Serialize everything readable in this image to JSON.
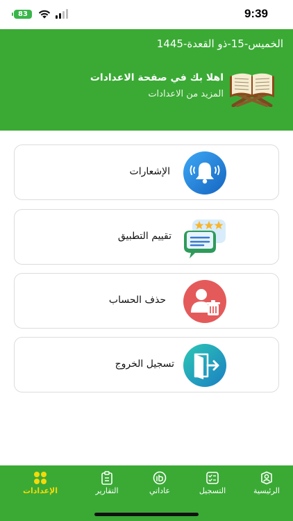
{
  "status_bar": {
    "battery": "83",
    "time": "9:39",
    "wifi_icon": "wifi-icon",
    "signal_icon": "cellular-signal-icon"
  },
  "header": {
    "date": "الخميس-15-ذو القعدة-1445",
    "title": "اهلا بك في صفحة الاعدادات",
    "subtitle": "المزيد من  الاعدادات",
    "icon": "quran-book-icon"
  },
  "settings": [
    {
      "label": "الإشعارات",
      "icon": "bell-icon"
    },
    {
      "label": "تقييم التطبيق",
      "icon": "rating-chat-icon"
    },
    {
      "label": "حذف الحساب",
      "icon": "delete-account-icon"
    },
    {
      "label": "تسجيل الخروج",
      "icon": "logout-icon"
    }
  ],
  "bottom_nav": {
    "active_color": "#f5d90a",
    "items": [
      {
        "label": "الإعدادات",
        "icon": "grid-icon",
        "active": true
      },
      {
        "label": "التقارير",
        "icon": "clipboard-icon",
        "active": false
      },
      {
        "label": "عاداتي",
        "icon": "habits-icon",
        "active": false
      },
      {
        "label": "التسجيل",
        "icon": "checklist-icon",
        "active": false
      },
      {
        "label": "الرئيسية",
        "icon": "profile-icon",
        "active": false
      }
    ]
  },
  "colors": {
    "primary_green": "#3aaa35",
    "bell_blue": "#1e88e5",
    "delete_red": "#e45a5a",
    "logout_teal": "#20b2aa"
  }
}
